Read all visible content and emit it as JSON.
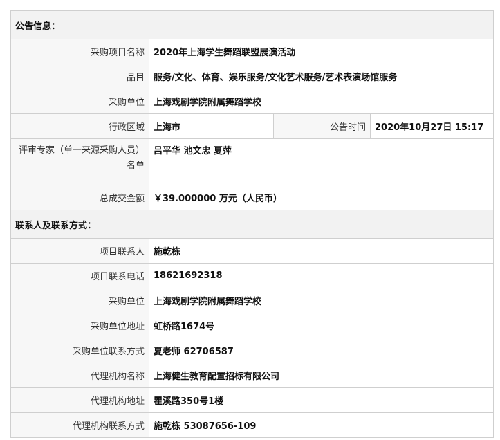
{
  "announcement": {
    "section_title": "公告信息：",
    "rows": {
      "project_name": {
        "label": "采购项目名称",
        "value": "2020年上海学生舞蹈联盟展演活动"
      },
      "category": {
        "label": "品目",
        "value": "服务/文化、体育、娱乐服务/文化艺术服务/艺术表演场馆服务"
      },
      "purchaser": {
        "label": "采购单位",
        "value": "上海戏剧学院附属舞蹈学校"
      },
      "region": {
        "label": "行政区域",
        "value": "上海市"
      },
      "publish_time": {
        "label": "公告时间",
        "value": "2020年10月27日  15:17"
      },
      "experts": {
        "label": "评审专家（单一来源采购人员）名单",
        "value": "吕平华 池文忠 夏萍"
      },
      "total_amount": {
        "label": "总成交金额",
        "value": "￥39.000000 万元（人民币）"
      }
    }
  },
  "contacts": {
    "section_title": "联系人及联系方式：",
    "rows": {
      "project_contact": {
        "label": "项目联系人",
        "value": "施乾栋"
      },
      "project_phone": {
        "label": "项目联系电话",
        "value": "18621692318"
      },
      "purchaser": {
        "label": "采购单位",
        "value": "上海戏剧学院附属舞蹈学校"
      },
      "purchaser_address": {
        "label": "采购单位地址",
        "value": "虹桥路1674号"
      },
      "purchaser_contact": {
        "label": "采购单位联系方式",
        "value": "夏老师 62706587"
      },
      "agency_name": {
        "label": "代理机构名称",
        "value": "上海健生教育配置招标有限公司"
      },
      "agency_address": {
        "label": "代理机构地址",
        "value": "瞿溪路350号1楼"
      },
      "agency_contact": {
        "label": "代理机构联系方式",
        "value": "施乾栋 53087656-109"
      }
    }
  }
}
